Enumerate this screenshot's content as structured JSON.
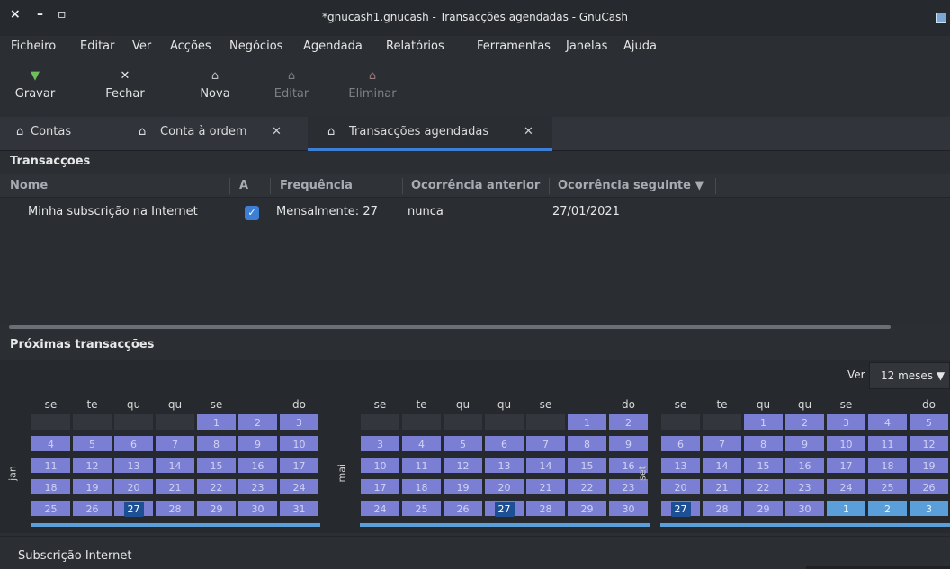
{
  "window": {
    "title": "*gnucash1.gnucash - Transacções agendadas - GnuCash",
    "close": "×",
    "minimize": "–",
    "maximize": "▫"
  },
  "menu": [
    "Ficheiro",
    "Editar",
    "Ver",
    "Acções",
    "Negócios",
    "Agendada",
    "Relatórios",
    "Ferramentas",
    "Janelas",
    "Ajuda"
  ],
  "toolbar": {
    "save": "Gravar",
    "close": "Fechar",
    "new": "Nova",
    "edit": "Editar",
    "delete": "Eliminar"
  },
  "tabs": [
    {
      "label": "Contas",
      "closable": false
    },
    {
      "label": "Conta à ordem",
      "closable": true
    },
    {
      "label": "Transacções agendadas",
      "closable": true,
      "active": true
    }
  ],
  "tab_close_glyph": "✕",
  "transactions": {
    "title": "Transacções",
    "columns": [
      "Nome",
      "A",
      "Frequência",
      "Ocorrência anterior",
      "Ocorrência seguinte ▼"
    ],
    "rows": [
      {
        "name": "Minha subscrição na Internet",
        "active": true,
        "frequency": "Mensalmente: 27",
        "previous": "nunca",
        "next": "27/01/2021"
      }
    ]
  },
  "upcoming": {
    "title": "Próximas transacções",
    "view_label": "Ver",
    "view_value": "12 meses ▼",
    "weekdays": [
      "se",
      "te",
      "qu",
      "qu",
      "se",
      "",
      "do"
    ],
    "months": [
      {
        "name": "jan",
        "days": [
          "",
          "",
          "",
          "",
          "1",
          "2",
          "3",
          "4",
          "5",
          "6",
          "7",
          "8",
          "9",
          "10",
          "11",
          "12",
          "13",
          "14",
          "15",
          "16",
          "17",
          "18",
          "19",
          "20",
          "21",
          "22",
          "23",
          "24",
          "25",
          "26",
          "27",
          "28",
          "29",
          "30",
          "31"
        ],
        "selected": "27"
      },
      {
        "name": "mai",
        "days": [
          "",
          "",
          "",
          "",
          "",
          "1",
          "2",
          "3",
          "4",
          "5",
          "6",
          "7",
          "8",
          "9",
          "10",
          "11",
          "12",
          "13",
          "14",
          "15",
          "16",
          "17",
          "18",
          "19",
          "20",
          "21",
          "22",
          "23",
          "24",
          "25",
          "26",
          "27",
          "28",
          "29",
          "30"
        ],
        "selected": "27"
      },
      {
        "name": "set",
        "days": [
          "",
          "",
          "1",
          "2",
          "3",
          "4",
          "5",
          "6",
          "7",
          "8",
          "9",
          "10",
          "11",
          "12",
          "13",
          "14",
          "15",
          "16",
          "17",
          "18",
          "19",
          "20",
          "21",
          "22",
          "23",
          "24",
          "25",
          "26",
          "27",
          "28",
          "29",
          "30",
          "1",
          "2",
          "3"
        ],
        "selected": "27",
        "next_month_days": [
          "1",
          "2",
          "3"
        ]
      }
    ]
  },
  "footer": {
    "label": "Subscrição Internet"
  },
  "colors": {
    "accent": "#3d7fd4",
    "day": "#7b7fd3",
    "next_month": "#5a9fd9",
    "selected": "#1d4f95"
  }
}
